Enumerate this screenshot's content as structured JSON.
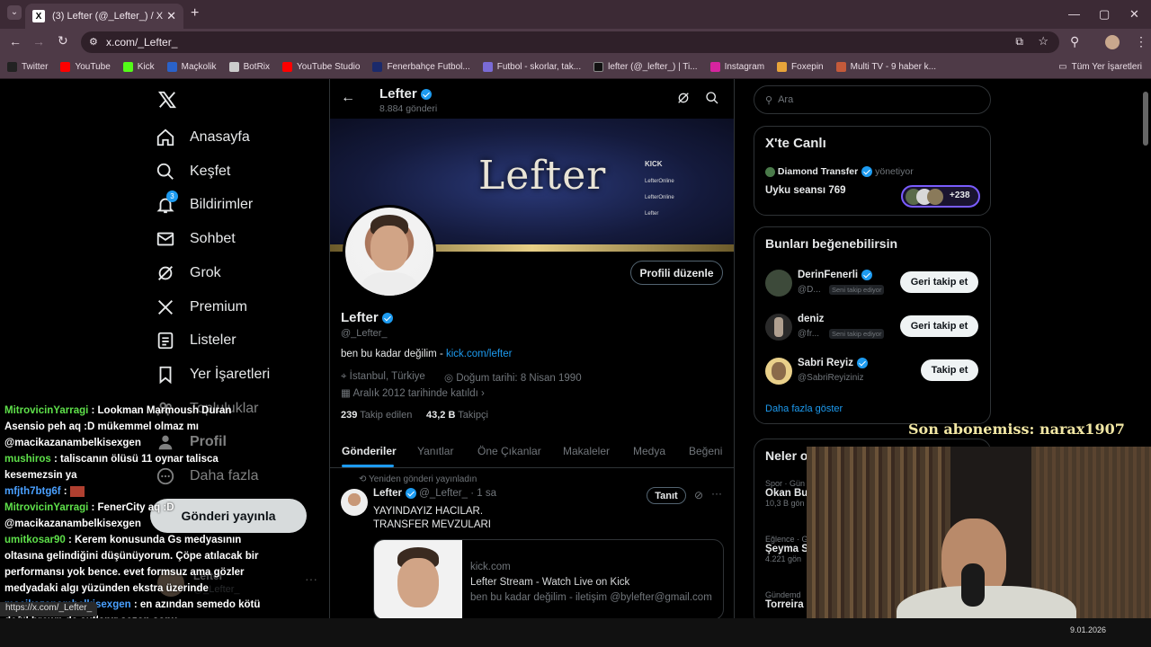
{
  "browser": {
    "tab_title": "(3) Lefter (@_Lefter_) / X",
    "new_tab": "+",
    "url": "x.com/_Lefter_",
    "window_controls": [
      "—",
      "▢",
      "✕"
    ],
    "bookmarks": [
      {
        "label": "Twitter",
        "color": "#1d1d1d"
      },
      {
        "label": "YouTube",
        "color": "#ff0000"
      },
      {
        "label": "Kick",
        "color": "#53fc18"
      },
      {
        "label": "Maçkolik",
        "color": "#2a62c9"
      },
      {
        "label": "BotRix",
        "color": "#cccccc"
      },
      {
        "label": "YouTube Studio",
        "color": "#ff0000"
      },
      {
        "label": "Fenerbahçe Futbol...",
        "color": "#1b2a6b"
      },
      {
        "label": "Futbol - skorlar, tak...",
        "color": "#7a6bd6"
      },
      {
        "label": "lefter (@_lefter_) | Ti...",
        "color": "#111111"
      },
      {
        "label": "Instagram",
        "color": "#d6249f"
      },
      {
        "label": "Foxepin",
        "color": "#e8a43a"
      },
      {
        "label": "Multi TV - 9 haber k...",
        "color": "#c45a3a"
      }
    ],
    "all_bookmarks": "Tüm Yer İşaretleri",
    "status_url": "https://x.com/_Lefter_"
  },
  "nav": {
    "items": [
      {
        "label": "Anasayfa",
        "icon": "home-icon"
      },
      {
        "label": "Keşfet",
        "icon": "search-icon"
      },
      {
        "label": "Bildirimler",
        "icon": "bell-icon",
        "badge": "3"
      },
      {
        "label": "Sohbet",
        "icon": "mail-icon"
      },
      {
        "label": "Grok",
        "icon": "grok-icon"
      },
      {
        "label": "Premium",
        "icon": "x-logo-icon"
      },
      {
        "label": "Listeler",
        "icon": "list-icon"
      },
      {
        "label": "Yer İşaretleri",
        "icon": "bookmark-icon"
      },
      {
        "label": "Topluluklar",
        "icon": "people-icon"
      },
      {
        "label": "Profil",
        "icon": "person-icon"
      },
      {
        "label": "Daha fazla",
        "icon": "more-circle-icon"
      }
    ],
    "post_button": "Gönderi yayınla",
    "account_name": "Lefter",
    "account_handle": "@_Lefter_"
  },
  "profile": {
    "name": "Lefter",
    "post_count": "8.884 gönderi",
    "banner_text": "Lefter",
    "banner_links": [
      "KICK",
      "LefterOnline",
      "LefterOnline",
      "Lefter"
    ],
    "handle": "@_Lefter_",
    "edit_button": "Profili düzenle",
    "bio_text": "ben bu kadar değilim - ",
    "bio_link": "kick.com/lefter",
    "location": "İstanbul, Türkiye",
    "birthday": "Doğum tarihi: 8 Nisan 1990",
    "joined": "Aralık 2012 tarihinde katıldı",
    "following_count": "239",
    "following_label": "Takip edilen",
    "followers_count": "43,2 B",
    "followers_label": "Takipçi",
    "tabs": [
      "Gönderiler",
      "Yanıtlar",
      "Öne Çıkanlar",
      "Makaleler",
      "Medya",
      "Beğeni"
    ]
  },
  "post": {
    "repost_label": "Yeniden gönderi yayınladın",
    "author": "Lefter",
    "handle": "@_Lefter_",
    "time": "· 1 sa",
    "promote": "Tanıt",
    "text_line1": "YAYINDAYIZ HACILAR.",
    "text_line2": "TRANSFER MEVZULARI",
    "card_domain": "kick.com",
    "card_title": "Lefter Stream - Watch Live on Kick",
    "card_desc": "ben bu kadar değilim - iletişim @bylefter@gmail.com"
  },
  "right": {
    "search_placeholder": "Ara",
    "live_title": "X'te Canlı",
    "live_host": "Diamond Transfer",
    "live_role": "yönetiyor",
    "live_space": "Uyku seansı 769",
    "live_listeners": "+238",
    "suggest_title": "Bunları beğenebilirsin",
    "suggestions": [
      {
        "name": "DerinFenerli",
        "handle": "@D...",
        "tag": "Seni takip ediyor",
        "button": "Geri takip et",
        "verified": true
      },
      {
        "name": "deniz",
        "handle": "@fr...",
        "tag": "Seni takip ediyor",
        "button": "Geri takip et",
        "verified": false
      },
      {
        "name": "Sabri Reyiz",
        "handle": "@SabriReyiziniz",
        "tag": "",
        "button": "Takip et",
        "verified": true
      }
    ],
    "show_more": "Daha fazla göster",
    "trends_title": "Neler o",
    "trends": [
      {
        "meta": "Spor · Gün",
        "name": "Okan Bu",
        "count": "10,3 B gön"
      },
      {
        "meta": "Eğlence · G",
        "name": "Şeyma S",
        "count": "4.221 gön"
      },
      {
        "meta": "Gündemd",
        "name": "Torreira",
        "count": ""
      }
    ]
  },
  "overlay": {
    "subscriber": "Son abonemiss: narax1907",
    "chat": [
      {
        "user": "MitrovicinYarragi",
        "color": "#5ee04a",
        "msg": " : Lookman Marmoush Duran Asensio peh aq :D mükemmel olmaz mı @macikazanambelkisexgen"
      },
      {
        "user": "mushiros",
        "color": "#5ee04a",
        "msg": " : taliscanın ölüsü 11 oynar talisca kesemezsin ya"
      },
      {
        "user": "mfjth7btg6f",
        "color": "#4aa0ff",
        "msg": " : "
      },
      {
        "user": "MitrovicinYarragi",
        "color": "#5ee04a",
        "msg": " : FenerCity aq :D @macikazanambelkisexgen"
      },
      {
        "user": "umitkosar90",
        "color": "#5ee04a",
        "msg": " : Kerem konusunda Gs medyasının oltasına gelindiğini düşünüyorum. Çöpe atılacak bir performansı yok bence. evet formsuz ama gözler medyadaki algı yüzünden ekstra üzerinde"
      },
      {
        "user": "macikazanambelkisexgen",
        "color": "#4aa0ff",
        "msg": " : en azından semedo kötü değil brown da şutlanır sezon sonu"
      }
    ],
    "taskbar_date": "9.01.2026"
  }
}
